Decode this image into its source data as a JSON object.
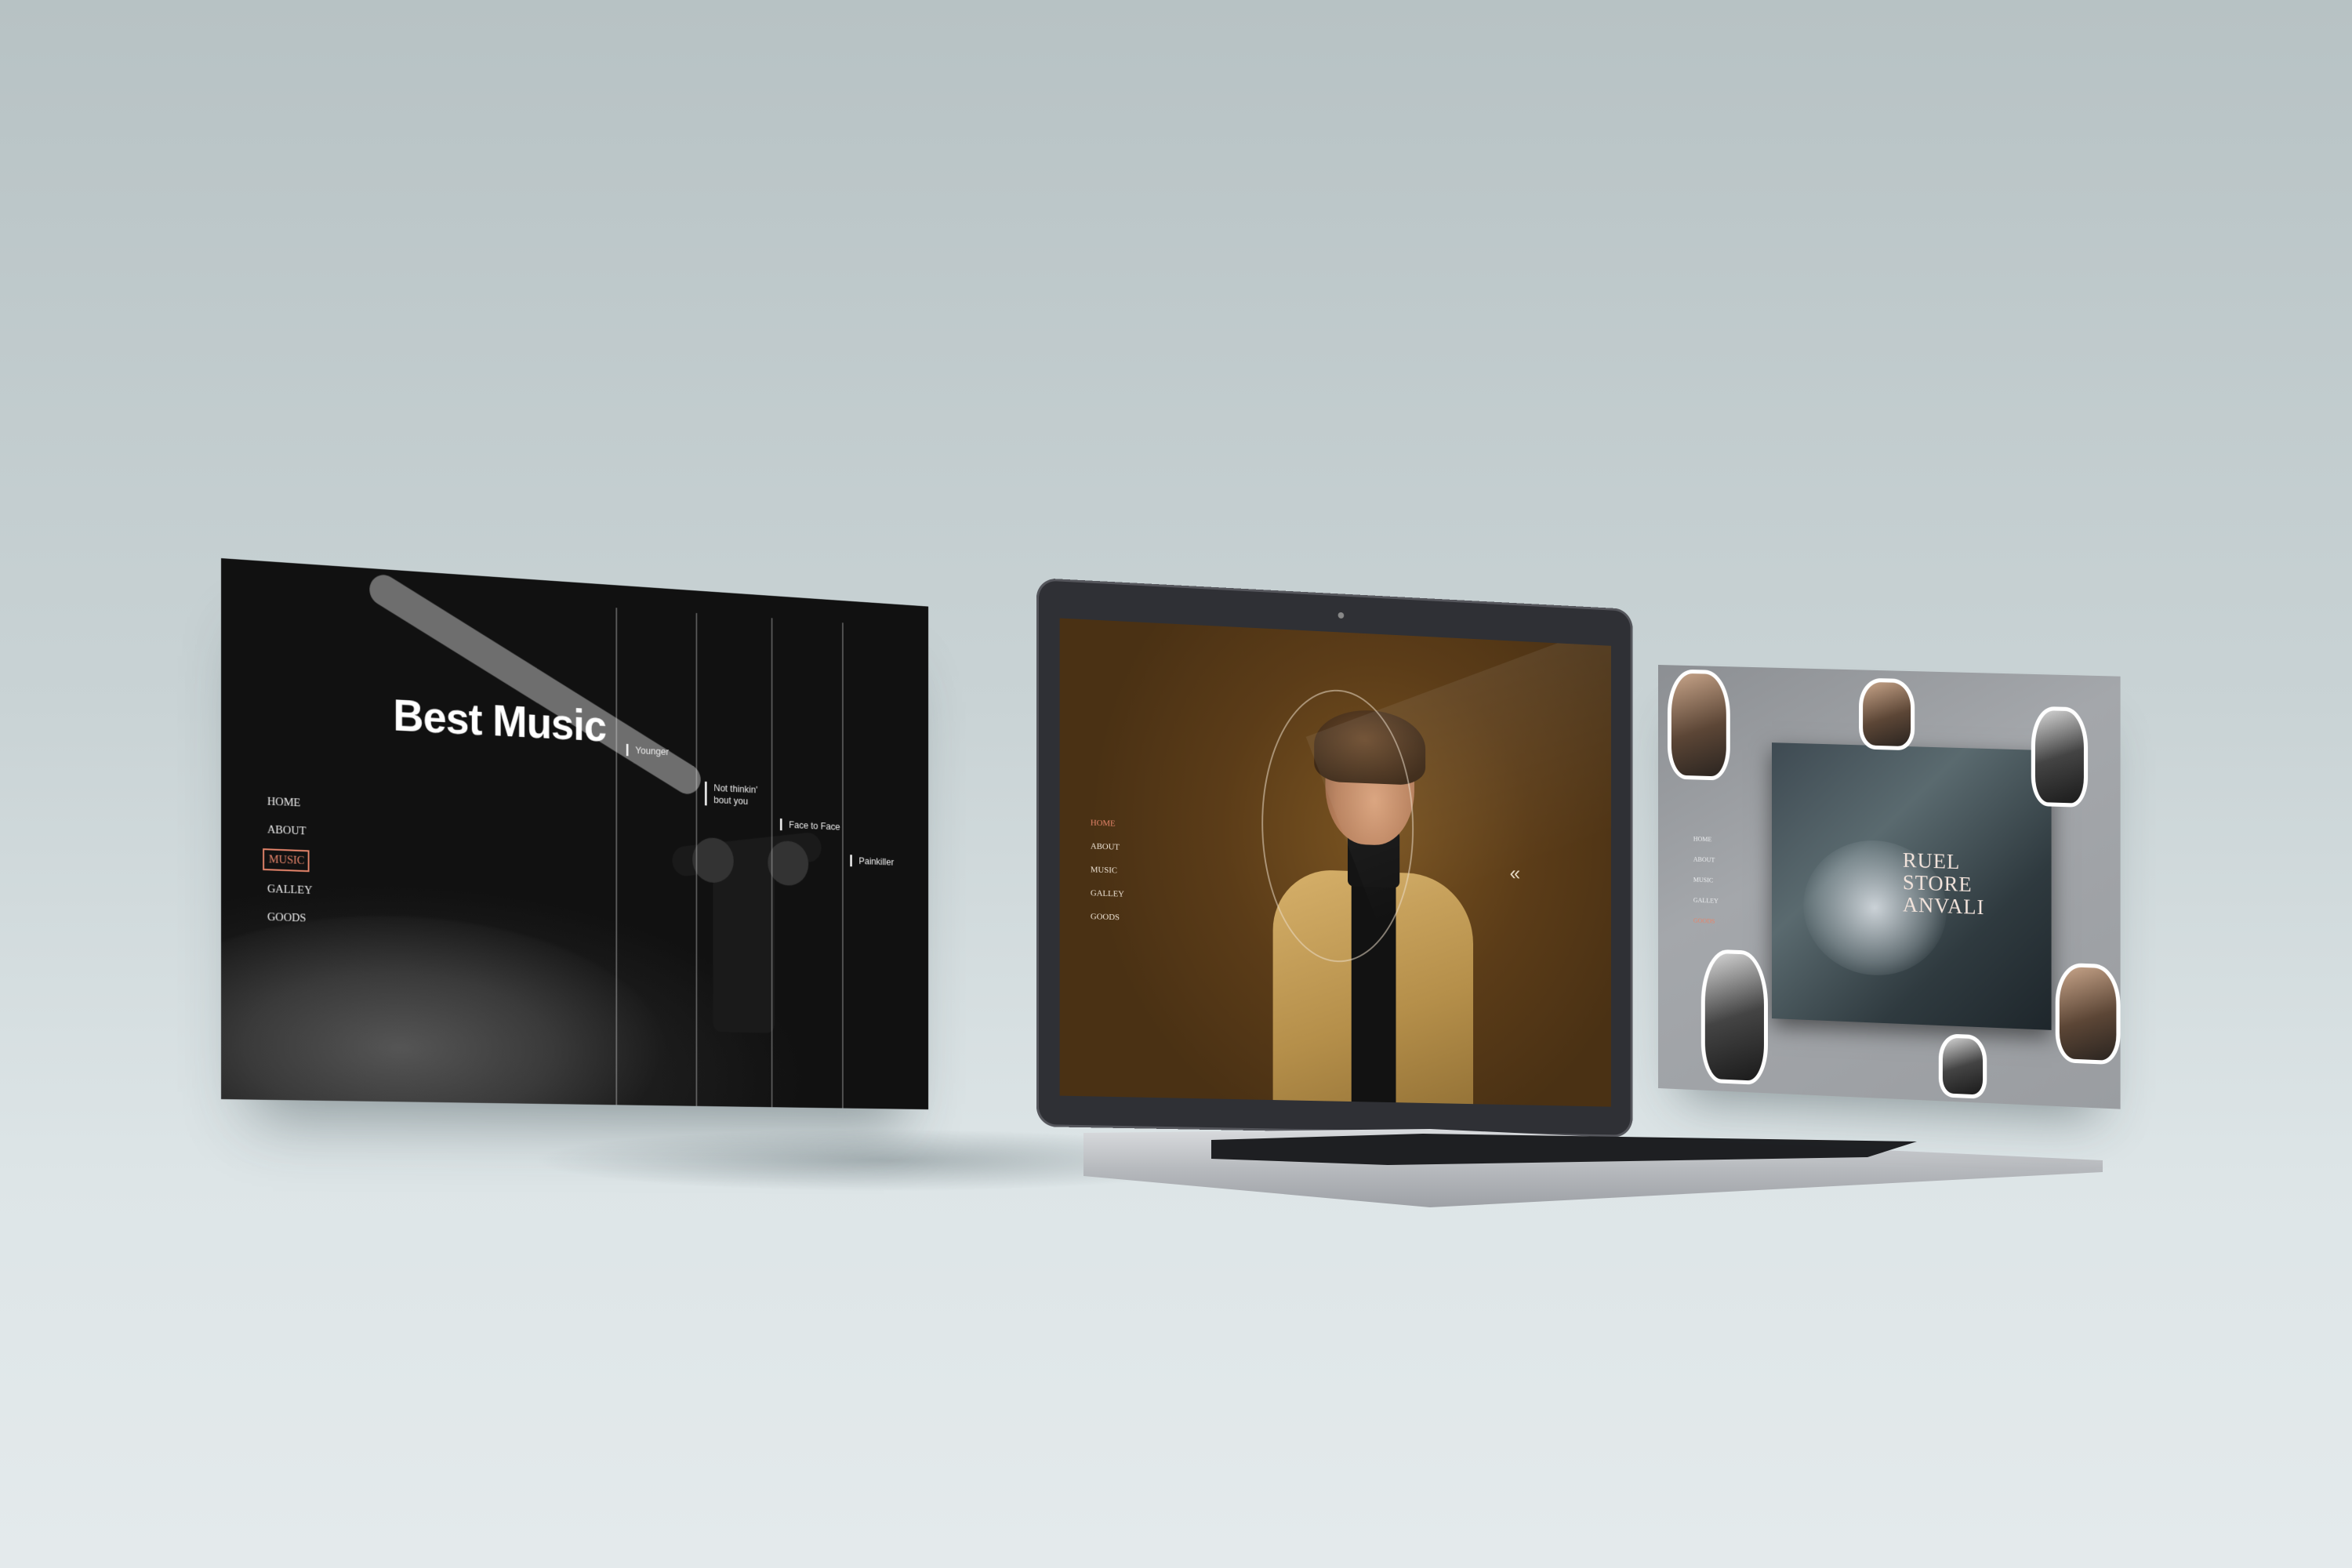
{
  "left_screen": {
    "title": "Best Music",
    "nav": [
      "HOME",
      "ABOUT",
      "MUSIC",
      "GALLEY",
      "GOODS"
    ],
    "active_nav": "MUSIC",
    "songs": [
      "Younger",
      "Not thinkin'",
      "bout you",
      "Face to Face",
      "Painkiller"
    ]
  },
  "laptop_screen": {
    "nav": [
      "HOME",
      "ABOUT",
      "MUSIC",
      "GALLEY",
      "GOODS"
    ],
    "active_nav": "HOME",
    "chevron": "«"
  },
  "right_screen": {
    "title_lines": [
      "RUEL",
      "STORE",
      "ANVALI"
    ],
    "nav": [
      "HOME",
      "ABOUT",
      "MUSIC",
      "GALLEY",
      "GOODS"
    ],
    "active_nav": "GOODS"
  },
  "colors": {
    "accent": "#e6856b",
    "background": "#c9d3d5",
    "laptop_bezel": "#2f3035",
    "laptop_wallpaper": "#5b3c18"
  },
  "icons": [
    "camera-icon",
    "chevron-double-left-icon"
  ]
}
